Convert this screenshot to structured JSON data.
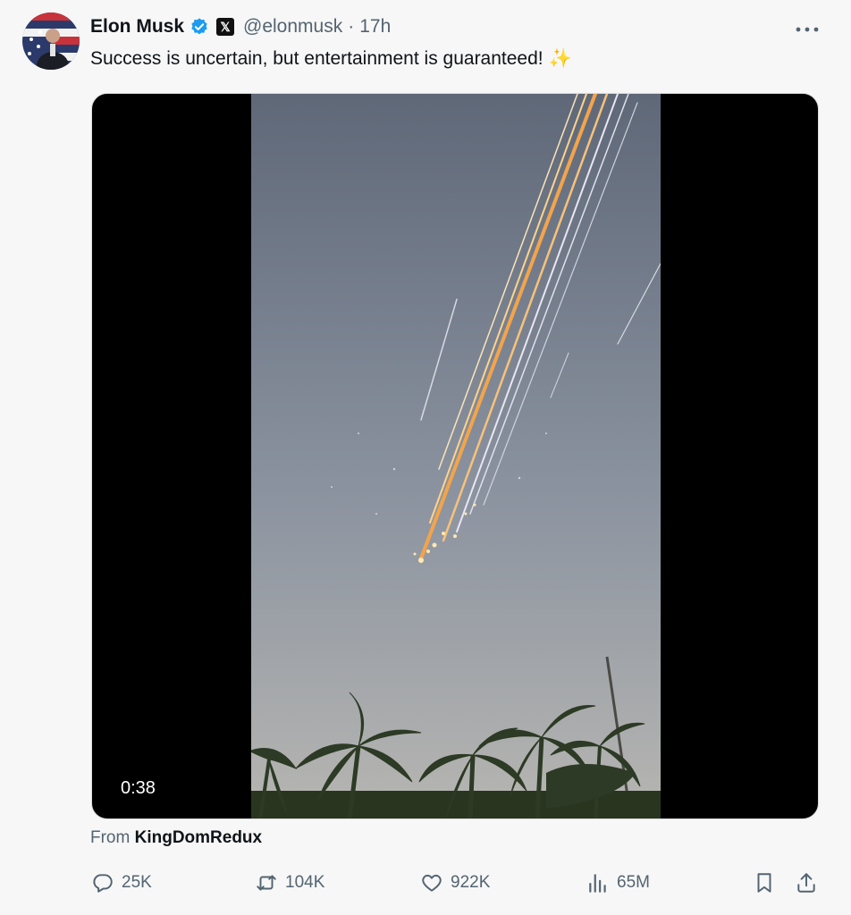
{
  "tweet": {
    "author_name": "Elon Musk",
    "handle": "@elonmusk",
    "separator": "·",
    "time": "17h",
    "text": "Success is uncertain, but entertainment is guaranteed!",
    "emoji": "✨",
    "more_icon": "more-horizontal-icon",
    "badge_x": "𝕏"
  },
  "media": {
    "duration": "0:38",
    "source_prefix": "From",
    "source_name": "KingDomRedux"
  },
  "actions": {
    "reply_count": "25K",
    "repost_count": "104K",
    "like_count": "922K",
    "views_count": "65M"
  },
  "colors": {
    "verified": "#1d9bf0",
    "muted": "#536471",
    "text": "#0f1419"
  }
}
